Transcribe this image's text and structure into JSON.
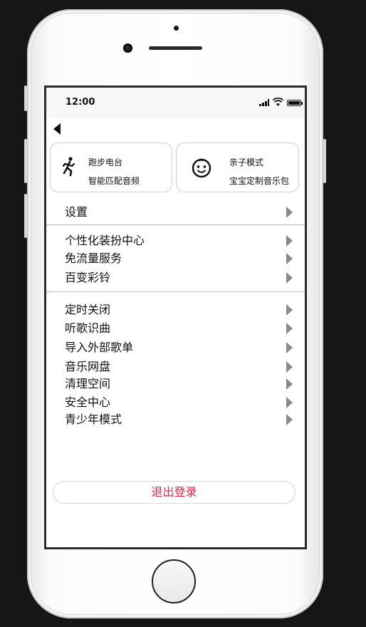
{
  "status_bar": {
    "time": "12:00",
    "signal_icon": "signal-icon",
    "wifi_icon": "wifi-icon",
    "battery_icon": "battery-icon"
  },
  "nav": {
    "back_icon": "back-arrow-icon"
  },
  "cards": [
    {
      "icon": "running-person-icon",
      "title": "跑步电台",
      "subtitle": "智能匹配音频"
    },
    {
      "icon": "baby-face-icon",
      "title": "亲子模式",
      "subtitle": "宝宝定制音乐包"
    }
  ],
  "sections": [
    {
      "items": [
        "设置"
      ]
    },
    {
      "items": [
        "个性化装扮中心",
        "免流量服务",
        "百变彩铃"
      ]
    },
    {
      "items": [
        "定时关闭",
        "听歌识曲",
        "导入外部歌单",
        "音乐网盘",
        "清理空间",
        "安全中心",
        "青少年模式"
      ]
    }
  ],
  "logout_label": "退出登录",
  "colors": {
    "accent": "#e0244a",
    "arrow": "#8a8a8a",
    "divider": "#bdbdbd"
  }
}
